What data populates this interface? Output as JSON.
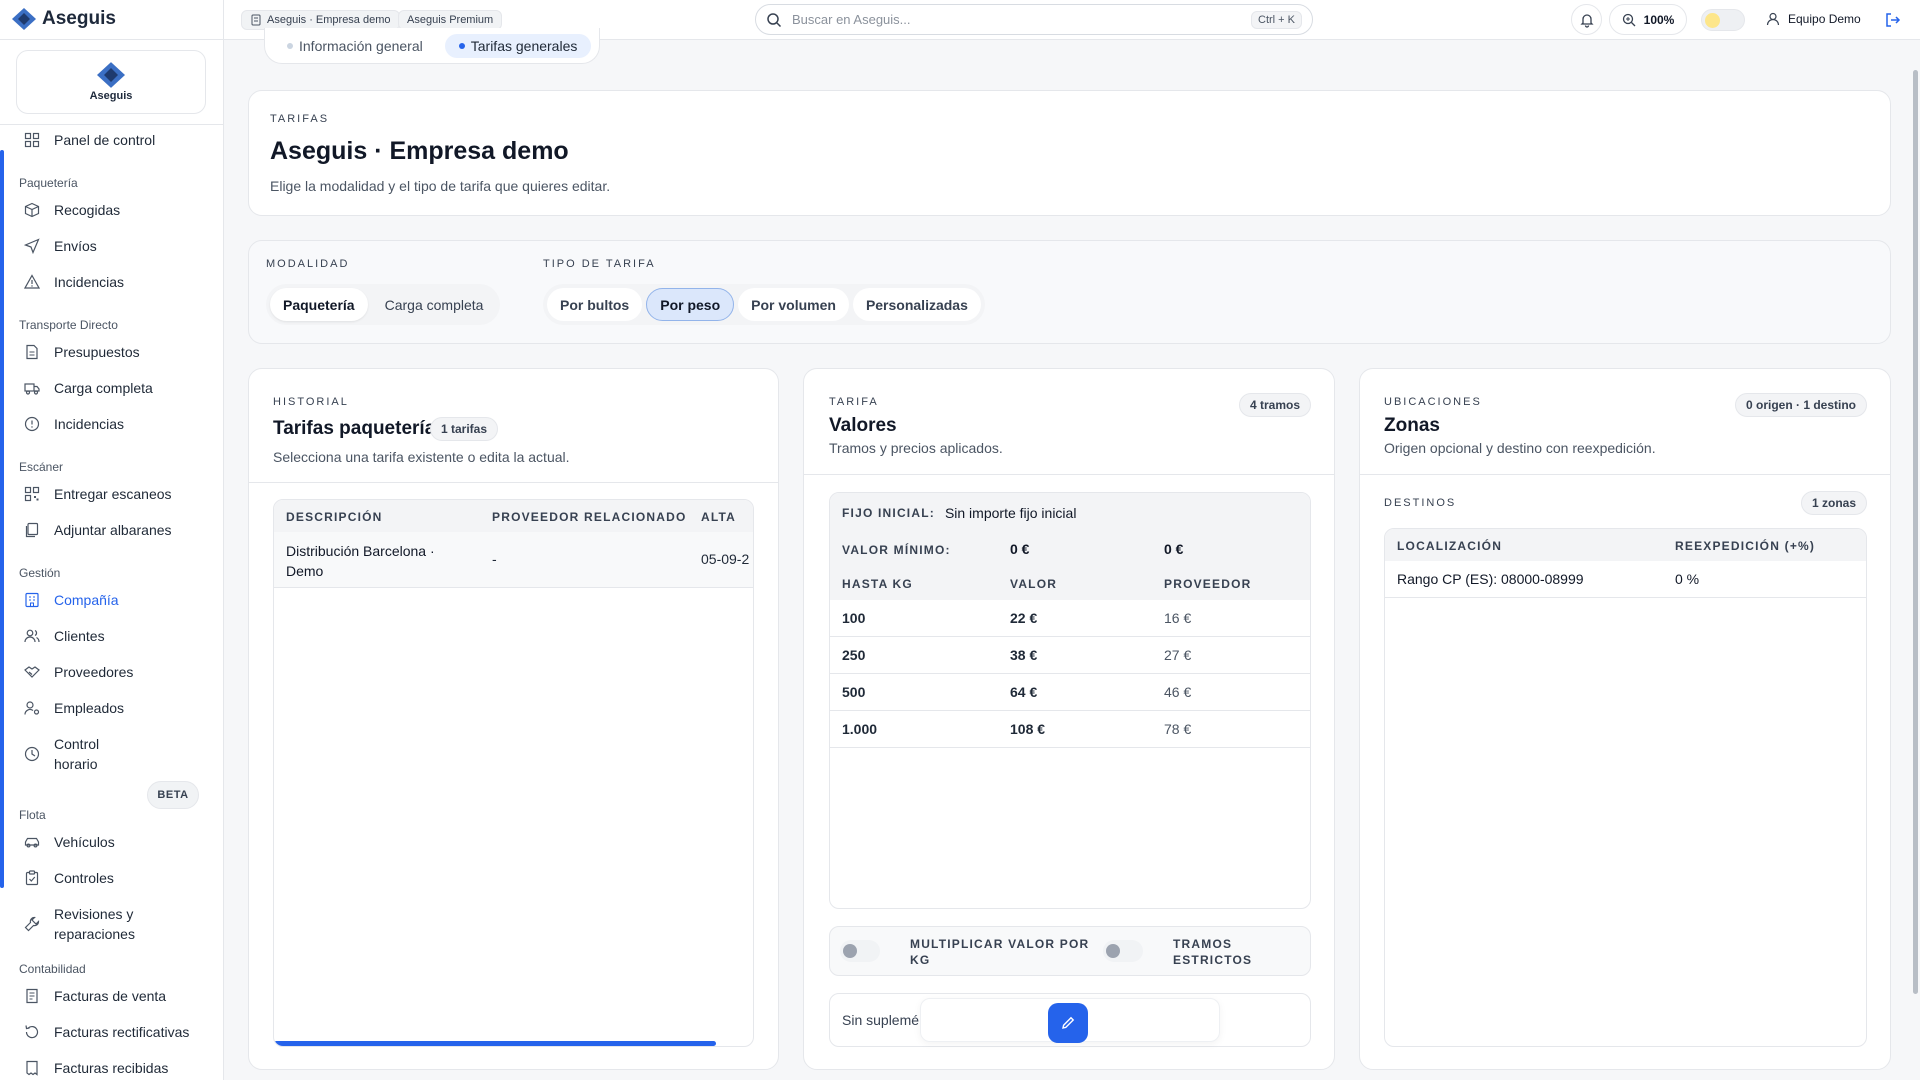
{
  "header": {
    "app_name": "Aseguis",
    "company_chip": "Aseguis · Empresa demo",
    "plan_chip": "Aseguis Premium",
    "search_placeholder": "Buscar en Aseguis...",
    "search_shortcut": "Ctrl + K",
    "zoom": "100%",
    "user_name": "Equipo Demo"
  },
  "sidebar": {
    "brand": "Aseguis",
    "dashboard": "Panel de control",
    "groups": {
      "paqueteria": "Paquetería",
      "transporte": "Transporte Directo",
      "escaner": "Escáner",
      "gestion": "Gestión",
      "flota": "Flota",
      "contabilidad": "Contabilidad"
    },
    "items": {
      "recogidas": "Recogidas",
      "envios": "Envíos",
      "incidencias_paq": "Incidencias",
      "presupuestos": "Presupuestos",
      "carga_completa": "Carga completa",
      "incidencias_td": "Incidencias",
      "entregar_escaneos": "Entregar escaneos",
      "adjuntar_albaranes": "Adjuntar albaranes",
      "compania": "Compañía",
      "clientes": "Clientes",
      "proveedores": "Proveedores",
      "empleados": "Empleados",
      "control_horario_1": "Control",
      "control_horario_2": "horario",
      "beta": "BETA",
      "vehiculos": "Vehículos",
      "controles": "Controles",
      "revisiones_1": "Revisiones y",
      "revisiones_2": "reparaciones",
      "facturas_venta": "Facturas de venta",
      "facturas_rect": "Facturas rectificativas",
      "facturas_recibidas": "Facturas recibidas"
    }
  },
  "tabs": {
    "general": "Información general",
    "tarifas": "Tarifas generales"
  },
  "hero": {
    "eyebrow": "Tarifas",
    "title": "Aseguis · Empresa demo",
    "subtitle": "Elige la modalidad y el tipo de tarifa que quieres editar."
  },
  "selector": {
    "modalidad_label": "Modalidad",
    "modalidad_options": [
      "Paquetería",
      "Carga completa"
    ],
    "tipo_label": "Tipo de tarifa",
    "tipo_options": [
      "Por bultos",
      "Por peso",
      "Por volumen",
      "Personalizadas"
    ]
  },
  "historial": {
    "eyebrow": "Historial",
    "title": "Tarifas paquetería",
    "count_badge": "1 tarifas",
    "subtitle": "Selecciona una tarifa existente o edita la actual.",
    "columns": [
      "Descripción",
      "Proveedor relacionado",
      "Alta"
    ],
    "rows": [
      {
        "desc_1": "Distribución Barcelona ·",
        "desc_2": "Demo",
        "proveedor": "-",
        "alta": "05-09-2"
      }
    ]
  },
  "valores": {
    "eyebrow": "Tarifa",
    "title": "Valores",
    "subtitle": "Tramos y precios aplicados.",
    "tramos_badge": "4 tramos",
    "fijo_label": "Fijo inicial:",
    "fijo_value": "Sin importe fijo inicial",
    "minimo_label": "Valor mínimo:",
    "minimo_valor": "0 €",
    "minimo_proveedor": "0 €",
    "columns": [
      "Hasta kg",
      "Valor",
      "Proveedor"
    ],
    "rows": [
      {
        "hasta": "100",
        "valor": "22 €",
        "proveedor": "16 €"
      },
      {
        "hasta": "250",
        "valor": "38 €",
        "proveedor": "27 €"
      },
      {
        "hasta": "500",
        "valor": "64 €",
        "proveedor": "46 €"
      },
      {
        "hasta": "1.000",
        "valor": "108 €",
        "proveedor": "78 €"
      }
    ],
    "toggle_multiplicar_1": "Multiplicar valor por",
    "toggle_multiplicar_2": "kg",
    "toggle_tramos_1": "Tramos",
    "toggle_tramos_2": "estrictos",
    "suplementos_text": "Sin suplemé"
  },
  "zonas": {
    "eyebrow": "Ubicaciones",
    "title": "Zonas",
    "subtitle": "Origen opcional y destino con reexpedición.",
    "summary_badge": "0 origen · 1 destino",
    "destinos_label": "Destinos",
    "destinos_badge": "1 zonas",
    "columns": [
      "Localización",
      "Reexpedición (+%)"
    ],
    "rows": [
      {
        "localizacion": "Rango CP (ES): 08000-08999",
        "reexpedicion": "0 %"
      }
    ]
  },
  "colors": {
    "accent": "#2563eb",
    "selected_bg": "#dbe7fb",
    "border": "#e5e7eb"
  }
}
